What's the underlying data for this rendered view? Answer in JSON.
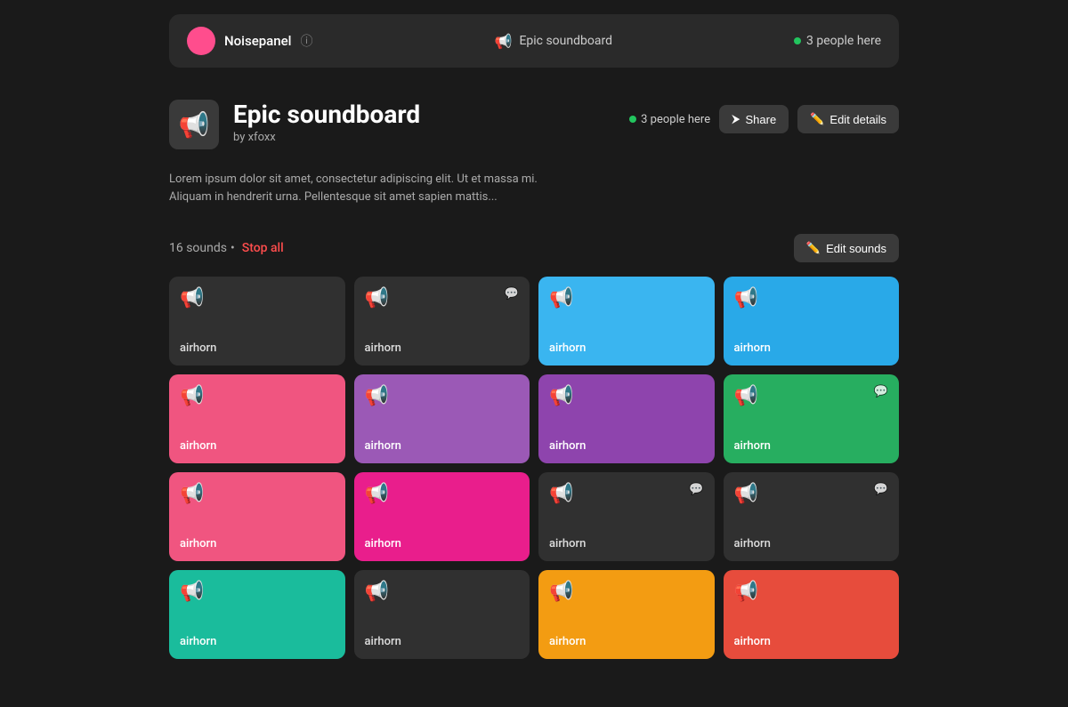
{
  "topbar": {
    "app_name": "Noisepanel",
    "info_icon": "ⓘ",
    "soundboard_icon": "📢",
    "soundboard_name": "Epic soundboard",
    "people_count": "3 people here"
  },
  "header": {
    "icon": "📢",
    "title": "Epic soundboard",
    "author": "by xfoxx",
    "people_count": "3 people here",
    "share_label": "Share",
    "edit_details_label": "Edit details",
    "description": "Lorem ipsum dolor sit amet, consectetur adipiscing elit. Ut et massa mi. Aliquam in hendrerit urna. Pellentesque sit amet sapien mattis..."
  },
  "controls": {
    "sounds_count": "16 sounds",
    "bullet": "•",
    "stop_all_label": "Stop all",
    "edit_sounds_label": "Edit sounds",
    "edit_icon": "✏️"
  },
  "cards": [
    {
      "id": 1,
      "label": "airhorn",
      "color": "dark",
      "has_bubble": false
    },
    {
      "id": 2,
      "label": "airhorn",
      "color": "dark",
      "has_bubble": true
    },
    {
      "id": 3,
      "label": "airhorn",
      "color": "blue",
      "has_bubble": false
    },
    {
      "id": 4,
      "label": "airhorn",
      "color": "blue2",
      "has_bubble": false
    },
    {
      "id": 5,
      "label": "airhorn",
      "color": "pink",
      "has_bubble": false
    },
    {
      "id": 6,
      "label": "airhorn",
      "color": "purple",
      "has_bubble": false
    },
    {
      "id": 7,
      "label": "airhorn",
      "color": "purple2",
      "has_bubble": false
    },
    {
      "id": 8,
      "label": "airhorn",
      "color": "green",
      "has_bubble": true
    },
    {
      "id": 9,
      "label": "airhorn",
      "color": "pink2",
      "has_bubble": false
    },
    {
      "id": 10,
      "label": "airhorn",
      "color": "pink3",
      "has_bubble": false
    },
    {
      "id": 11,
      "label": "airhorn",
      "color": "dark",
      "has_bubble": true
    },
    {
      "id": 12,
      "label": "airhorn",
      "color": "dark",
      "has_bubble": true
    },
    {
      "id": 13,
      "label": "airhorn",
      "color": "teal",
      "has_bubble": false
    },
    {
      "id": 14,
      "label": "airhorn",
      "color": "dark",
      "has_bubble": false
    },
    {
      "id": 15,
      "label": "airhorn",
      "color": "orange",
      "has_bubble": false
    },
    {
      "id": 16,
      "label": "airhorn",
      "color": "red",
      "has_bubble": false
    }
  ]
}
